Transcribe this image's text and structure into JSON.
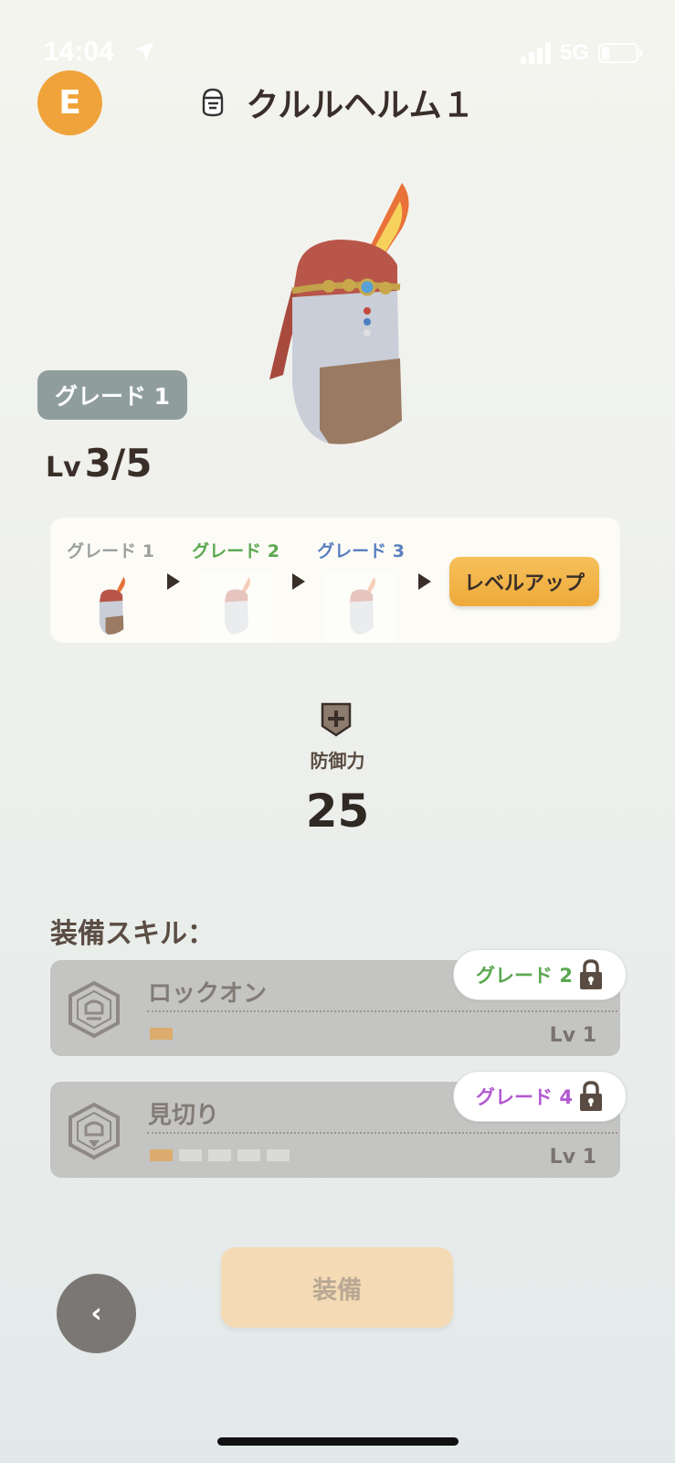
{
  "status_bar": {
    "time": "14:04",
    "network": "5G"
  },
  "rank_badge": "E",
  "title": "クルルヘルム１",
  "grade_pill": "グレード 1",
  "level": {
    "label": "Lv",
    "value": "3/5"
  },
  "grade_progression": {
    "stages": [
      {
        "label": "グレード 1",
        "color": "#9aa09e"
      },
      {
        "label": "グレード 2",
        "color": "#5aa84f"
      },
      {
        "label": "グレード 3",
        "color": "#5a7fbf"
      }
    ],
    "level_up_label": "レベルアップ"
  },
  "defense": {
    "label": "防御力",
    "value": "25"
  },
  "skills_heading": "装備スキル：",
  "skills": [
    {
      "name": "ロックオン",
      "level": "Lv 1",
      "filled": 1,
      "total": 1,
      "unlock_label": "グレード 2",
      "unlock_color": "#5aa84f"
    },
    {
      "name": "見切り",
      "level": "Lv 1",
      "filled": 1,
      "total": 5,
      "unlock_label": "グレード 4",
      "unlock_color": "#b25ad0"
    }
  ],
  "back_label": "‹",
  "equip_label": "装備"
}
